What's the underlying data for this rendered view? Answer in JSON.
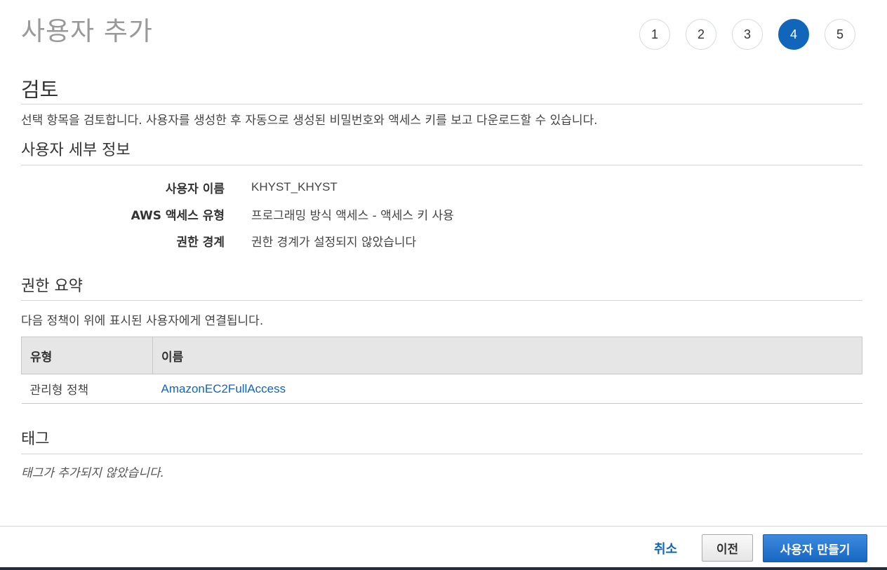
{
  "page_title": "사용자 추가",
  "steps": [
    "1",
    "2",
    "3",
    "4",
    "5"
  ],
  "active_step": 4,
  "review": {
    "heading": "검토",
    "description": "선택 항목을 검토합니다. 사용자를 생성한 후 자동으로 생성된 비밀번호와 액세스 키를 보고 다운로드할 수 있습니다."
  },
  "user_details": {
    "heading": "사용자 세부 정보",
    "rows": [
      {
        "label": "사용자 이름",
        "value": "KHYST_KHYST"
      },
      {
        "label": "AWS 액세스 유형",
        "value": "프로그래밍 방식 액세스 - 액세스 키 사용"
      },
      {
        "label": "권한 경계",
        "value": "권한 경계가 설정되지 않았습니다"
      }
    ]
  },
  "permissions": {
    "heading": "권한 요약",
    "description": "다음 정책이 위에 표시된 사용자에게 연결됩니다.",
    "columns": [
      "유형",
      "이름"
    ],
    "rows": [
      {
        "type": "관리형 정책",
        "name": "AmazonEC2FullAccess"
      }
    ]
  },
  "tags": {
    "heading": "태그",
    "empty_text": "태그가 추가되지 않았습니다."
  },
  "footer": {
    "cancel_label": "취소",
    "previous_label": "이전",
    "create_label": "사용자 만들기"
  },
  "colors": {
    "accent": "#1166bb",
    "title_gray": "#999999",
    "table_header_bg": "#e6e6e6"
  }
}
